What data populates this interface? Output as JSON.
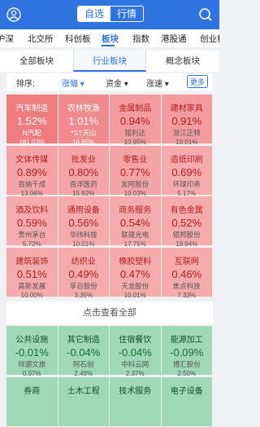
{
  "header": {
    "tabs": [
      "自选",
      "行情"
    ]
  },
  "nav": {
    "tabs": [
      "沪深",
      "北交所",
      "科创板",
      "板块",
      "指数",
      "港股通",
      "创业板"
    ]
  },
  "subtabs": [
    "全部板块",
    "行业板块",
    "概念板块"
  ],
  "sort": {
    "label": "排序:",
    "options": [
      "涨幅",
      "资金",
      "涨速"
    ],
    "more": "更多"
  },
  "cells": [
    {
      "name": "汽车制造",
      "pct": "1.52%",
      "stock": "N汽配",
      "rate": "181.03%"
    },
    {
      "name": "农林牧渔",
      "pct": "1.01%",
      "stock": "*ST天山",
      "rate": "16.65%"
    },
    {
      "name": "金属制品",
      "pct": "0.94%",
      "stock": "铭利达",
      "rate": "10.95%"
    },
    {
      "name": "建材家具",
      "pct": "0.91%",
      "stock": "浙江正特",
      "rate": "10.01%"
    },
    {
      "name": "文体传媒",
      "pct": "0.89%",
      "stock": "百纳千成",
      "rate": "13.06%"
    },
    {
      "name": "批发业",
      "pct": "0.80%",
      "stock": "百洋医药",
      "rate": "15.92%"
    },
    {
      "name": "零售业",
      "pct": "0.77%",
      "stock": "友阿股份",
      "rate": "10.03%"
    },
    {
      "name": "造纸印刷",
      "pct": "0.69%",
      "stock": "环球印务",
      "rate": "5.17%"
    },
    {
      "name": "酒及饮料",
      "pct": "0.59%",
      "stock": "贵州茅台",
      "rate": "5.72%"
    },
    {
      "name": "通用设备",
      "pct": "0.56%",
      "stock": "华纬科技",
      "rate": "10.01%"
    },
    {
      "name": "商务服务",
      "pct": "0.54%",
      "stock": "联建光电",
      "rate": "17.75%"
    },
    {
      "name": "有色金属",
      "pct": "0.52%",
      "stock": "银邦股份",
      "rate": "19.94%"
    },
    {
      "name": "建筑装饰",
      "pct": "0.51%",
      "stock": "高新发展",
      "rate": "10.00%"
    },
    {
      "name": "纺织业",
      "pct": "0.49%",
      "stock": "孚日股份",
      "rate": "3.35%"
    },
    {
      "name": "橡胶塑料",
      "pct": "0.47%",
      "stock": "天龙股份",
      "rate": "10.01%"
    },
    {
      "name": "互联网",
      "pct": "0.46%",
      "stock": "焦点科技",
      "rate": "7.33%"
    }
  ],
  "view_all": "点击查看全部",
  "cells_down": [
    {
      "name": "公共设施",
      "pct": "-0.01%",
      "stock": "祥源文旅",
      "rate": "0.97%"
    },
    {
      "name": "其它制造",
      "pct": "-0.04%",
      "stock": "阿石创",
      "rate": "2.49%"
    },
    {
      "name": "住宿餐饮",
      "pct": "-0.04%",
      "stock": "中科云网",
      "rate": "2.37%"
    },
    {
      "name": "能源加工",
      "pct": "-0.09%",
      "stock": "博汇股份",
      "rate": "2.50%"
    },
    {
      "name": "券商",
      "pct": "",
      "stock": "",
      "rate": ""
    },
    {
      "name": "土木工程",
      "pct": "",
      "stock": "",
      "rate": ""
    },
    {
      "name": "技术服务",
      "pct": "",
      "stock": "",
      "rate": ""
    },
    {
      "name": "电子设备",
      "pct": "",
      "stock": "",
      "rate": ""
    }
  ],
  "colors": {
    "brand": "#2f73e0",
    "up": "#d5262b",
    "down": "#1d8a4a"
  }
}
